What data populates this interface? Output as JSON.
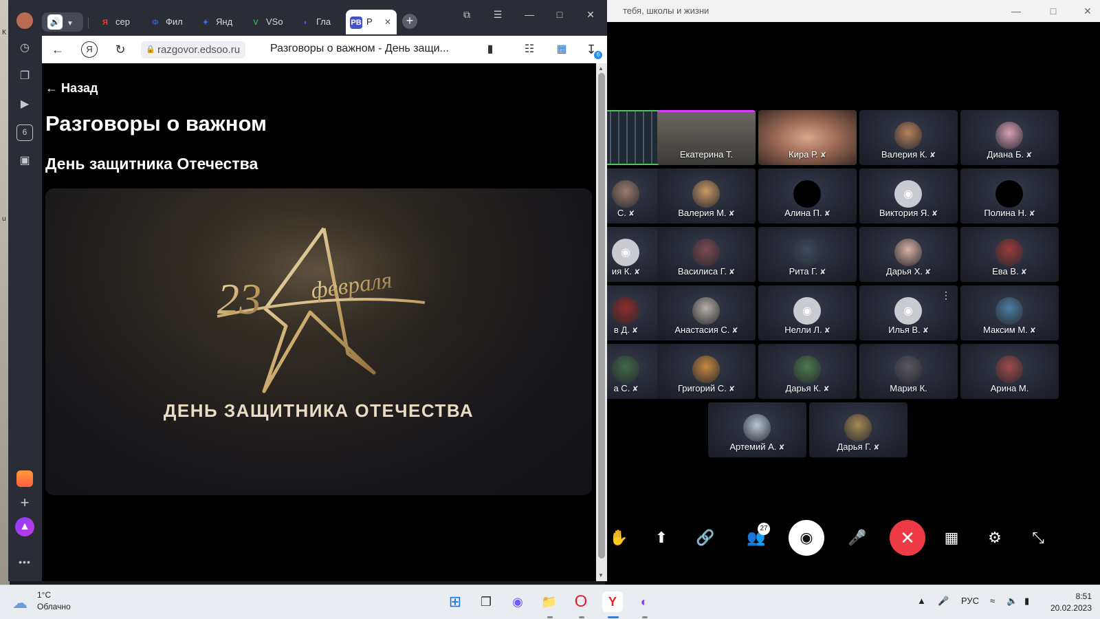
{
  "desktop": {
    "peek_letters": [
      "К",
      "u"
    ]
  },
  "browser": {
    "tabs": [
      {
        "label": "сер",
        "icon": "yandex-icon",
        "color": "#ff3333",
        "glyph": "Я"
      },
      {
        "label": "Фил",
        "icon": "doc-icon",
        "color": "#2d5cc8",
        "glyph": "Ф"
      },
      {
        "label": "Янд",
        "icon": "yandex-ai-icon",
        "color": "#3a6df0",
        "glyph": "✦"
      },
      {
        "label": "VSo",
        "icon": "vsource-icon",
        "color": "#2fb35a",
        "glyph": "V"
      },
      {
        "label": "Гла",
        "icon": "globe-icon",
        "color": "#6a4cf5",
        "glyph": "◐"
      },
      {
        "label": "Р",
        "icon": "rv-icon",
        "color": "#4553c9",
        "glyph": "РВ",
        "active": true
      }
    ],
    "address": {
      "url": "razgovor.edsoo.ru",
      "page_title": "Разговоры о важном - День защи...",
      "downloads_count": "6"
    },
    "sidebar": {
      "counter": "6"
    }
  },
  "page": {
    "back_label": "← Назад",
    "title": "Разговоры о важном",
    "subtitle": "День защитника Отечества",
    "banner": {
      "number": "23",
      "month": "февраля",
      "caption": "ДЕНЬ ЗАЩИТНИКА ОТЕЧЕСТВА"
    }
  },
  "conference": {
    "window_title": "тебя, школы и жизни",
    "participants_count": "27",
    "tiles": [
      {
        "name": "",
        "kind": "screen",
        "active": true
      },
      {
        "name": "Екатерина Т.",
        "kind": "video",
        "speaking": true,
        "muted": false
      },
      {
        "name": "Кира Р.",
        "kind": "video",
        "muted": true
      },
      {
        "name": "Валерия К.",
        "kind": "photo",
        "color": "#b8835c",
        "muted": true
      },
      {
        "name": "Диана Б.",
        "kind": "photo",
        "color": "#d8a0b4",
        "muted": true
      },
      {
        "name": "С.",
        "kind": "photo",
        "color": "#9a7d6d",
        "muted": true
      },
      {
        "name": "Валерия М.",
        "kind": "photo",
        "color": "#c99a66",
        "muted": true
      },
      {
        "name": "Алина П.",
        "kind": "black",
        "muted": true
      },
      {
        "name": "Виктория Я.",
        "kind": "cam",
        "muted": true
      },
      {
        "name": "Полина Н.",
        "kind": "black",
        "muted": true
      },
      {
        "name": "ия К.",
        "kind": "cam",
        "muted": true
      },
      {
        "name": "Василиса Г.",
        "kind": "photo",
        "color": "#7b4a52",
        "muted": true
      },
      {
        "name": "Рита Г.",
        "kind": "photo",
        "color": "#3c4a60",
        "muted": true
      },
      {
        "name": "Дарья Х.",
        "kind": "photo",
        "color": "#d9b3a3",
        "muted": true
      },
      {
        "name": "Ева В.",
        "kind": "photo",
        "color": "#9a3b3b",
        "muted": true
      },
      {
        "name": "в Д.",
        "kind": "photo",
        "color": "#8e2b2b",
        "muted": true
      },
      {
        "name": "Анастасия С.",
        "kind": "photo",
        "color": "#b7b0a8",
        "muted": true
      },
      {
        "name": "Нелли Л.",
        "kind": "cam",
        "muted": true
      },
      {
        "name": "Илья В.",
        "kind": "cam",
        "muted": true,
        "menu": true
      },
      {
        "name": "Максим М.",
        "kind": "photo",
        "color": "#4d7fa6",
        "muted": true
      },
      {
        "name": "а С.",
        "kind": "photo",
        "color": "#3e6a4a",
        "muted": true
      },
      {
        "name": "Григорий С.",
        "kind": "photo",
        "color": "#c78a3e",
        "muted": true
      },
      {
        "name": "Дарья К.",
        "kind": "photo",
        "color": "#4c7a4c",
        "muted": true
      },
      {
        "name": "Мария К.",
        "kind": "photo",
        "color": "#5a5860",
        "muted": false
      },
      {
        "name": "Арина М.",
        "kind": "photo",
        "color": "#a04a4a",
        "muted": false
      },
      {
        "name": "Артемий А.",
        "kind": "photo",
        "color": "#b9c6d6",
        "muted": true
      },
      {
        "name": "Дарья Г.",
        "kind": "photo",
        "color": "#a88a55",
        "muted": true
      }
    ]
  },
  "taskbar": {
    "weather_temp": "1°C",
    "weather_desc": "Облачно",
    "language": "РУС",
    "time": "8:51",
    "date": "20.02.2023"
  },
  "colors": {
    "accent_green": "#4fc35d",
    "hangup_red": "#ee3a44",
    "tab_strip": "#2b2d36"
  }
}
